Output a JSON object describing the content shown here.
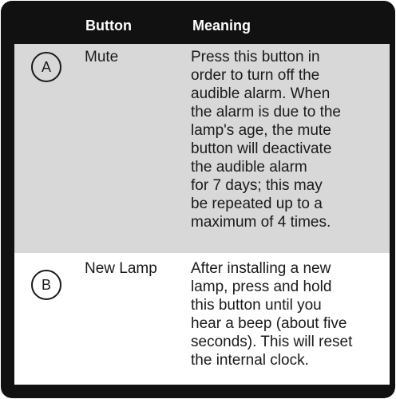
{
  "header": {
    "button_col": "Button",
    "meaning_col": "Meaning"
  },
  "rows": [
    {
      "badge": "A",
      "button": "Mute",
      "meaning": "Press this button in\norder to turn off the\naudible alarm. When\nthe alarm is due to the\nlamp's age, the mute\nbutton will deactivate\nthe audible alarm\nfor 7 days; this may\nbe repeated up to a\nmaximum of 4 times."
    },
    {
      "badge": "B",
      "button": "New Lamp",
      "meaning": "After installing a new\nlamp, press and hold\nthis button until you\nhear a beep (about five\nseconds). This will reset\nthe internal clock."
    }
  ],
  "colors": {
    "frame": "#111111",
    "row_a_bg": "#d8d8d8",
    "row_b_bg": "#ffffff",
    "header_text": "#ffffff"
  }
}
